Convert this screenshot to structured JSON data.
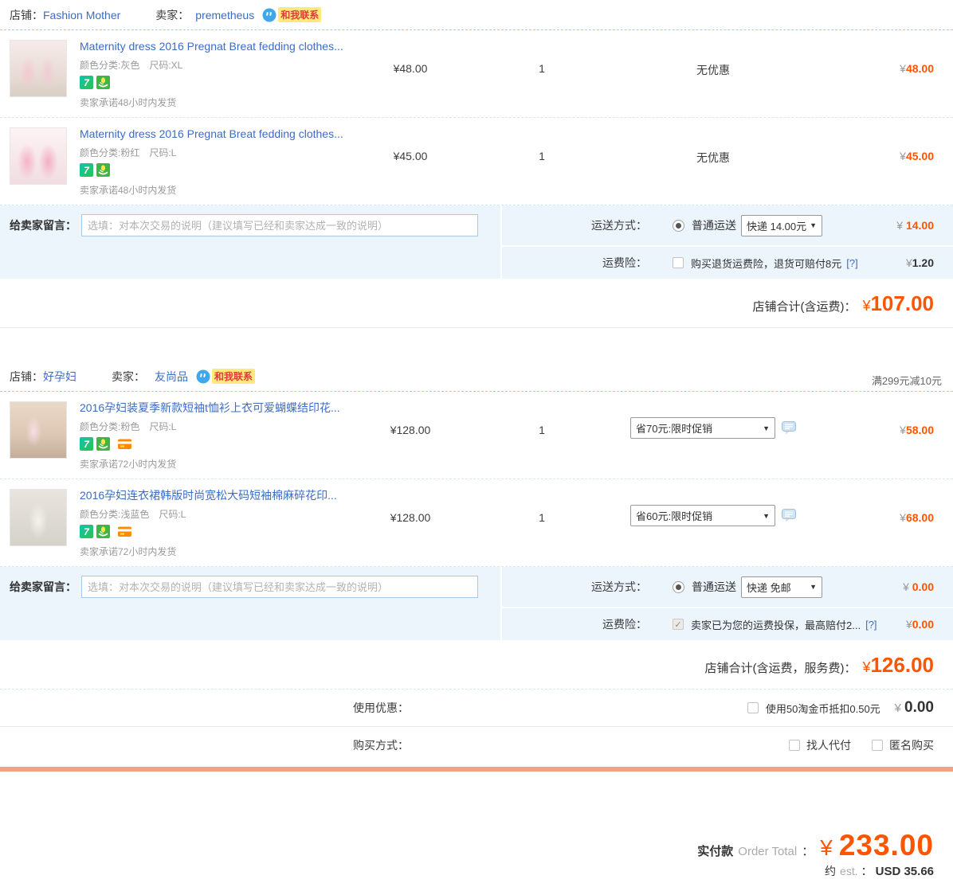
{
  "icons": {
    "seven_glyph": "7",
    "dropdown_arrow": "▼",
    "check_glyph": "✓"
  },
  "colors": {
    "accent_orange": "#ff5500",
    "link_blue": "#3c6cc4",
    "band_blue": "#ecf4fc",
    "badge_bg": "#ffe87c",
    "badge_text": "#e4393c",
    "divider_orange": "#f4a27c"
  },
  "shop1": {
    "shop_label": "店铺：",
    "shop_name": "Fashion Mother",
    "seller_label": "卖家：",
    "seller_name": "premetheus",
    "contact_label": "和我联系",
    "items": [
      {
        "title": "Maternity dress 2016 Pregnat Breat fedding clothes...",
        "specs": "颜色分类:灰色　尺码:XL",
        "promise": "卖家承诺48小时内发货",
        "unit_price": "¥48.00",
        "qty": "1",
        "discount": "无优惠",
        "currency": "¥",
        "subtotal": "48.00"
      },
      {
        "title": "Maternity dress 2016 Pregnat Breat fedding clothes...",
        "specs": "颜色分类:粉红　尺码:L",
        "promise": "卖家承诺48小时内发货",
        "unit_price": "¥45.00",
        "qty": "1",
        "discount": "无优惠",
        "currency": "¥",
        "subtotal": "45.00"
      }
    ],
    "message": {
      "label": "给卖家留言：",
      "placeholder": "选填：对本次交易的说明（建议填写已经和卖家达成一致的说明）"
    },
    "shipping": {
      "label": "运送方式：",
      "method": "普通运送",
      "select_value": "快递 14.00元",
      "currency": "¥ ",
      "price": "14.00"
    },
    "insurance": {
      "label": "运费险：",
      "text": "购买退货运费险，退货可赔付8元",
      "help": "[?]",
      "currency": "¥",
      "price": "1.20"
    },
    "subtotal": {
      "label": "店铺合计(含运费)：",
      "currency": "¥",
      "value": "107.00"
    }
  },
  "shop2": {
    "shop_label": "店铺：",
    "shop_name": "好孕妇",
    "seller_label": "卖家：",
    "seller_name": "友尚品",
    "contact_label": "和我联系",
    "promo": "满299元减10元",
    "items": [
      {
        "title": "2016孕妇装夏季新款短袖t恤衫上衣可爱蝴蝶结印花...",
        "specs": "颜色分类:粉色　尺码:L",
        "promise": "卖家承诺72小时内发货",
        "unit_price": "¥128.00",
        "qty": "1",
        "discount_select": "省70元:限时促销",
        "currency": "¥",
        "subtotal": "58.00"
      },
      {
        "title": "2016孕妇连衣裙韩版时尚宽松大码短袖棉麻碎花印...",
        "specs": "颜色分类:浅蓝色　尺码:L",
        "promise": "卖家承诺72小时内发货",
        "unit_price": "¥128.00",
        "qty": "1",
        "discount_select": "省60元:限时促销",
        "currency": "¥",
        "subtotal": "68.00"
      }
    ],
    "message": {
      "label": "给卖家留言：",
      "placeholder": "选填：对本次交易的说明（建议填写已经和卖家达成一致的说明）"
    },
    "shipping": {
      "label": "运送方式：",
      "method": "普通运送",
      "select_value": "快递 免邮",
      "currency": "¥ ",
      "price": "0.00"
    },
    "insurance": {
      "label": "运费险：",
      "text": "卖家已为您的运费投保，最高赔付2...",
      "help": "[?]",
      "currency": "¥",
      "price": "0.00"
    },
    "subtotal": {
      "label": "店铺合计(含运费，服务费)：",
      "currency": "¥",
      "value": "126.00"
    }
  },
  "coupon": {
    "label": "使用优惠：",
    "option": "使用50淘金币抵扣0.50元",
    "currency": "¥",
    "price": "0.00"
  },
  "purchase": {
    "label": "购买方式：",
    "options": [
      "找人代付",
      "匿名购买"
    ]
  },
  "order_total": {
    "label_cn": "实付款",
    "label_en": "Order Total",
    "colon": "：",
    "currency": "¥",
    "value": "233.00",
    "est_cn": "约",
    "est_en": "est.",
    "est_colon": "：",
    "est_value": "USD 35.66"
  }
}
